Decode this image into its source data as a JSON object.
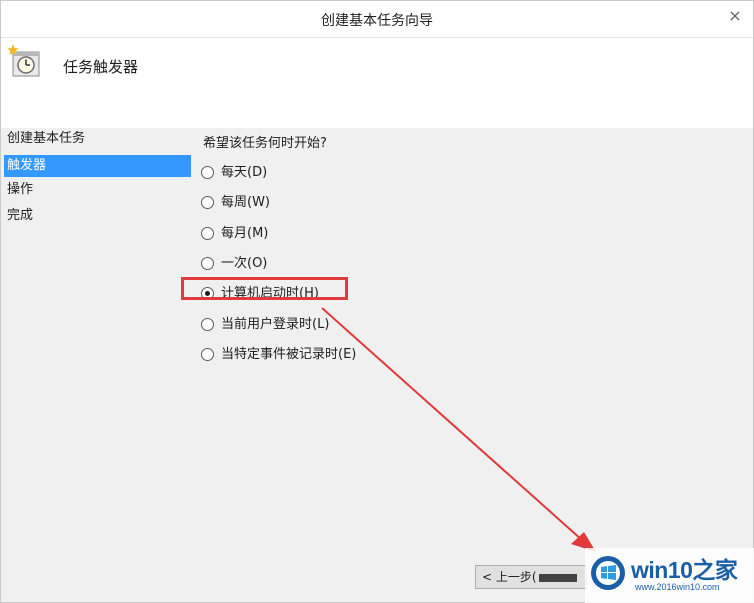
{
  "window": {
    "title": "创建基本任务向导",
    "close_label": "×"
  },
  "header": {
    "title": "任务触发器",
    "icon": "task-clock-icon"
  },
  "sidebar": {
    "steps": [
      {
        "label": "创建基本任务",
        "active": false
      },
      {
        "label": "触发器",
        "active": true
      },
      {
        "label": "操作",
        "active": false
      },
      {
        "label": "完成",
        "active": false
      }
    ]
  },
  "content": {
    "question": "希望该任务何时开始?",
    "options": [
      {
        "label": "每天(D)",
        "checked": false
      },
      {
        "label": "每周(W)",
        "checked": false
      },
      {
        "label": "每月(M)",
        "checked": false
      },
      {
        "label": "一次(O)",
        "checked": false
      },
      {
        "label": "计算机启动时(H)",
        "checked": true
      },
      {
        "label": "当前用户登录时(L)",
        "checked": false
      },
      {
        "label": "当特定事件被记录时(E)",
        "checked": false
      }
    ]
  },
  "footer": {
    "back_label": "< 上一步("
  },
  "annotation": {
    "color": "#e03a3a"
  },
  "watermark": {
    "brand": "win10之家",
    "url": "www.2016win10.com"
  },
  "colors": {
    "selection": "#3399ff",
    "brand": "#1a5ea8"
  }
}
